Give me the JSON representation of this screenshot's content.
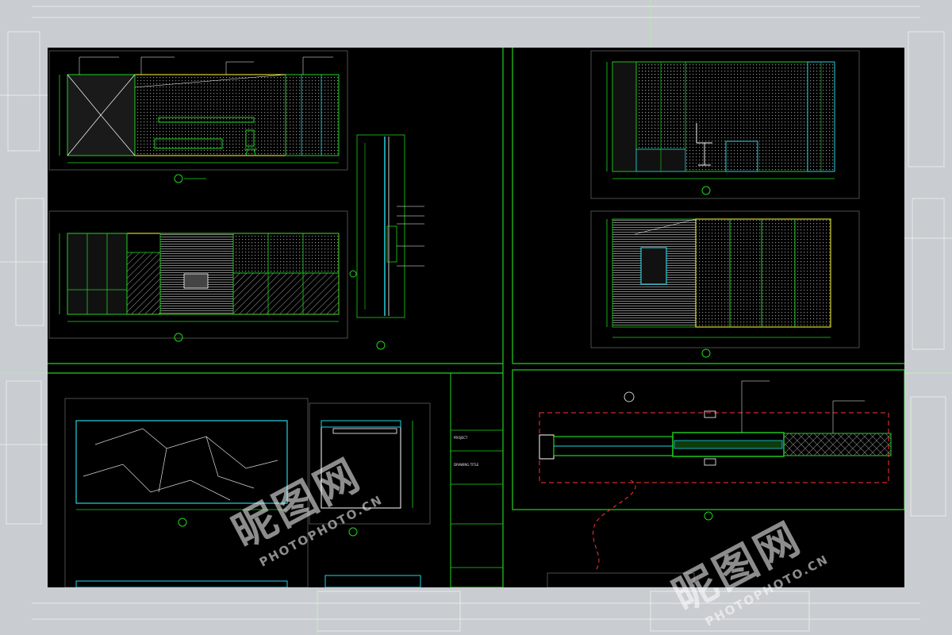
{
  "colors": {
    "page_background": "#c9ccd0",
    "drawing_background": "#000000",
    "frame_line": "#1fd31f",
    "wall_outline": "#ffff33",
    "detail_line": "#ffffff",
    "glass_line": "#22d3e0",
    "section_line": "#ff3333"
  },
  "title_block": {
    "project_label": "PROJECT",
    "drawing_title_label": "DRAWING TITLE"
  },
  "watermark": {
    "brand": "昵图网",
    "domain": "PHOTOPHOTO.CN"
  },
  "icons": [
    "section-marker-icon",
    "chair-icon",
    "stone-vein-pattern-icon",
    "hatch-pattern-icon"
  ]
}
